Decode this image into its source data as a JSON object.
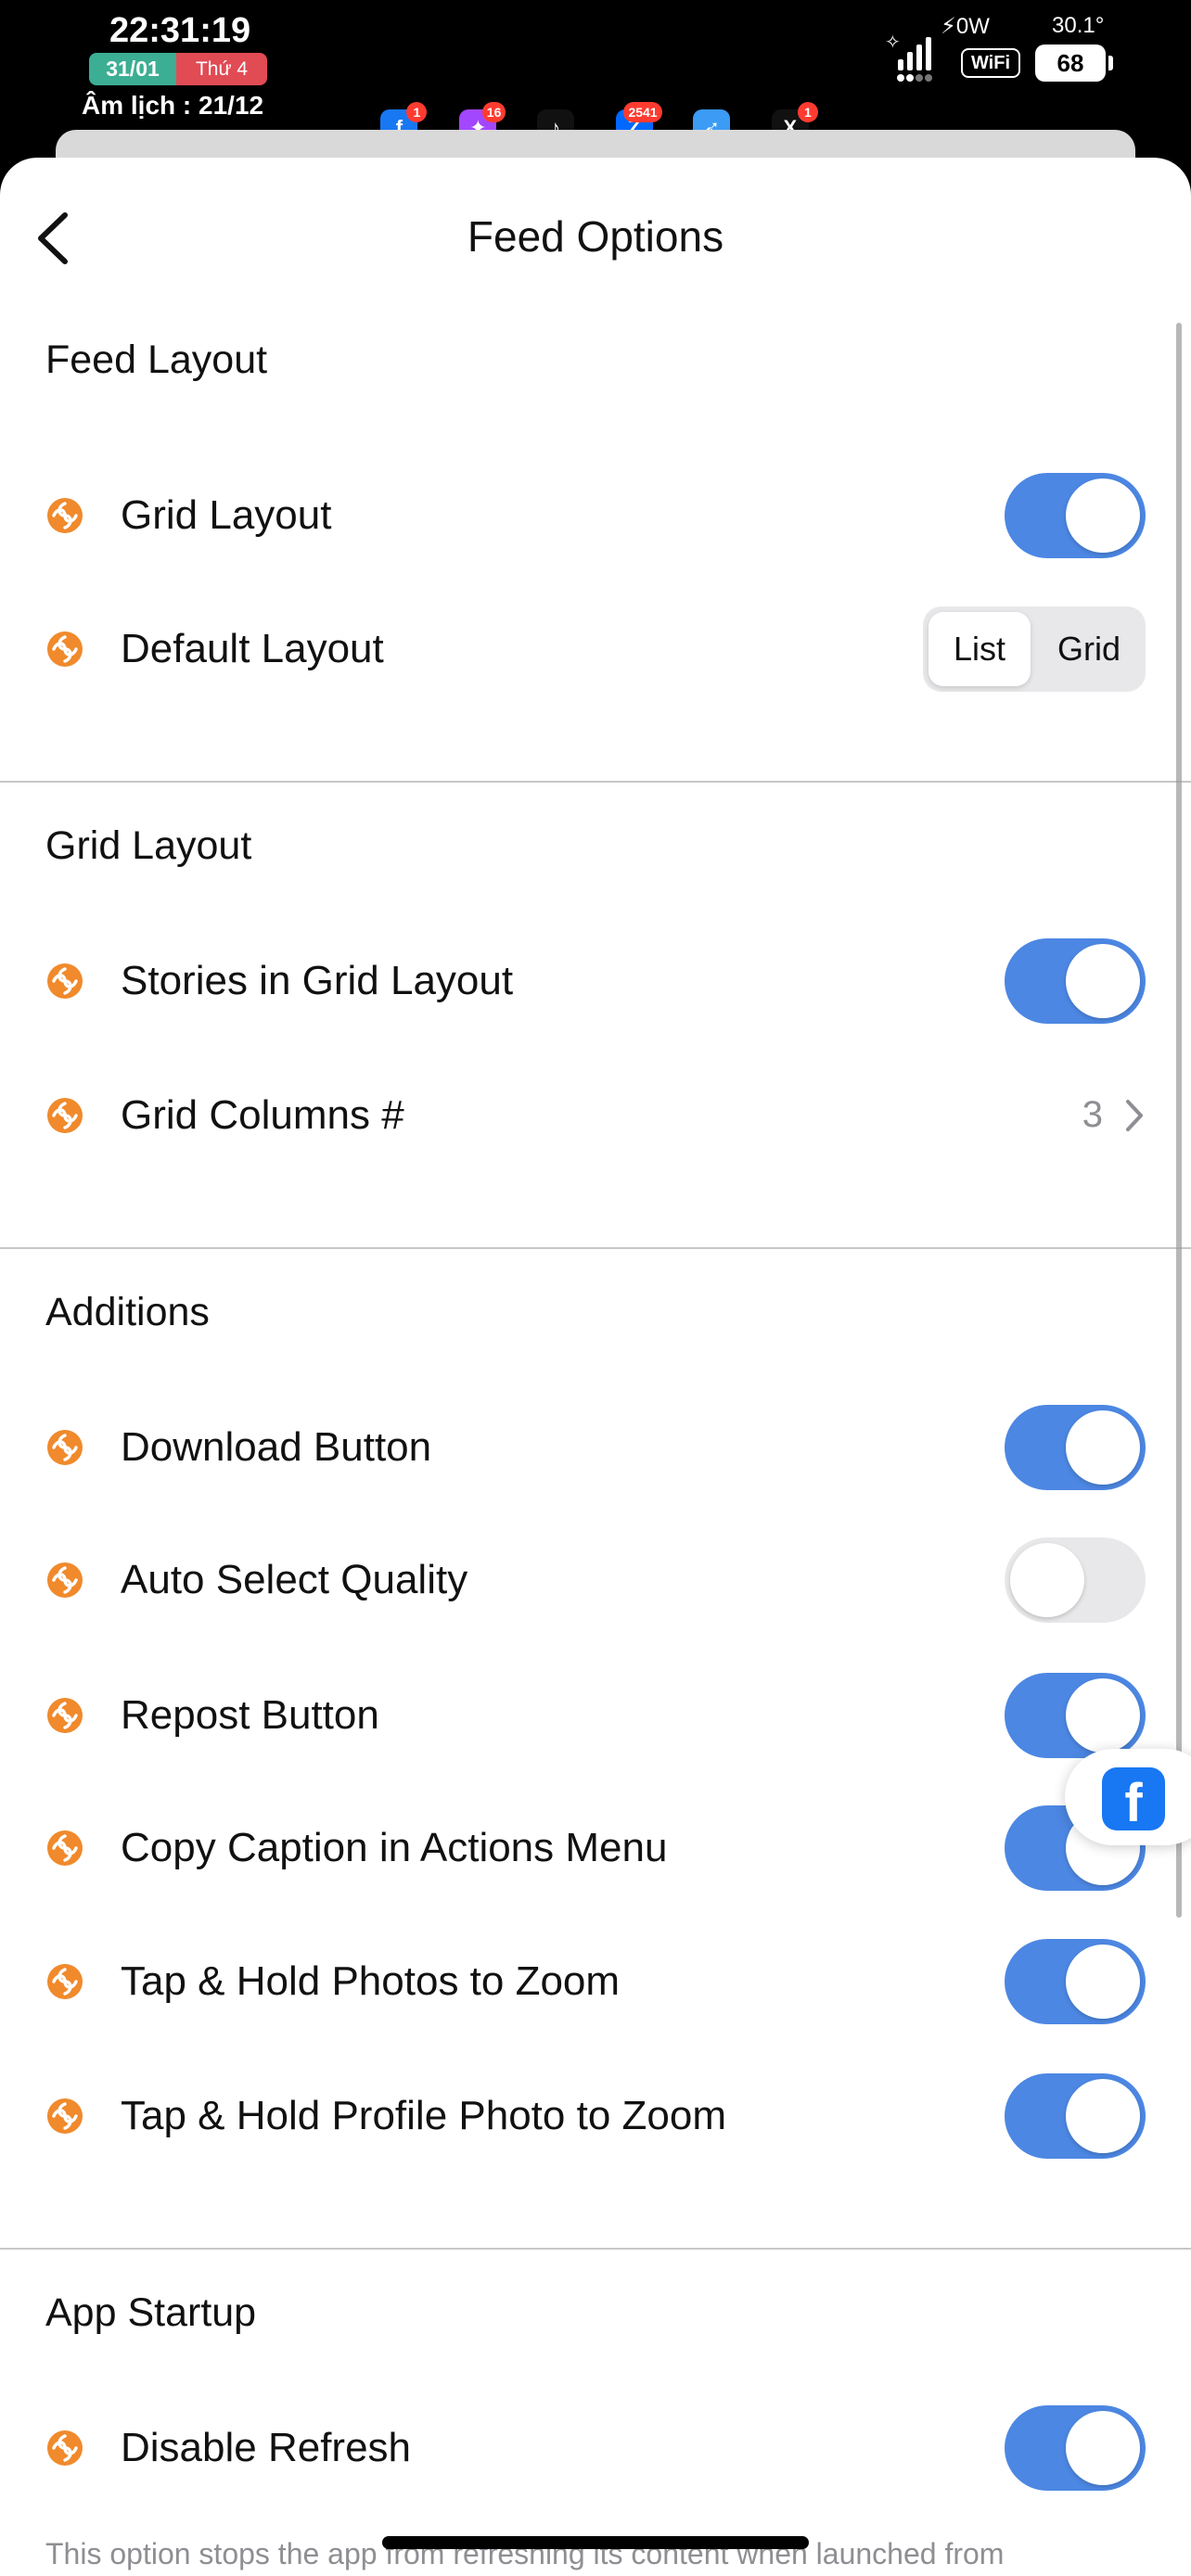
{
  "status_bar": {
    "time": "22:31:19",
    "date": "31/01",
    "weekday": "Thứ 4",
    "lunar": "Âm lịch : 21/12",
    "power": "⚡0W",
    "temperature": "30.1°",
    "wifi_label": "WiFi",
    "battery": "68",
    "apps": [
      {
        "icon": "facebook-icon",
        "glyph": "f",
        "color": "#1877f2",
        "badge": "1"
      },
      {
        "icon": "messenger-icon",
        "glyph": "✦",
        "color": "#a347ff",
        "badge": "16"
      },
      {
        "icon": "tiktok-icon",
        "glyph": "♪",
        "color": "#111111",
        "badge": ""
      },
      {
        "icon": "zalo-icon",
        "glyph": "Z",
        "color": "#0068ff",
        "badge": "2541"
      },
      {
        "icon": "safari-icon",
        "glyph": "➶",
        "color": "#3b9bf5",
        "badge": ""
      },
      {
        "icon": "x-icon",
        "glyph": "X",
        "color": "#111111",
        "badge": "1"
      }
    ]
  },
  "nav": {
    "title": "Feed Options"
  },
  "sections": [
    {
      "title": "Feed Layout",
      "rows": [
        {
          "label": "Grid Layout",
          "control": "toggle",
          "on": true
        },
        {
          "label": "Default Layout",
          "control": "segmented",
          "options": [
            "List",
            "Grid"
          ],
          "selected": "List"
        }
      ]
    },
    {
      "title": "Grid Layout",
      "rows": [
        {
          "label": "Stories in Grid Layout",
          "control": "toggle",
          "on": true
        },
        {
          "label": "Grid Columns #",
          "control": "value",
          "value": "3"
        }
      ]
    },
    {
      "title": "Additions",
      "rows": [
        {
          "label": "Download Button",
          "control": "toggle",
          "on": true
        },
        {
          "label": "Auto Select Quality",
          "control": "toggle",
          "on": false
        },
        {
          "label": "Repost Button",
          "control": "toggle",
          "on": true
        },
        {
          "label": "Copy Caption in Actions Menu",
          "control": "toggle",
          "on": true
        },
        {
          "label": "Tap & Hold Photos to Zoom",
          "control": "toggle",
          "on": true
        },
        {
          "label": "Tap & Hold Profile Photo to Zoom",
          "control": "toggle",
          "on": true
        }
      ]
    },
    {
      "title": "App Startup",
      "rows": [
        {
          "label": "Disable Refresh",
          "control": "toggle",
          "on": true
        }
      ],
      "footnote": "This option stops the app from refreshing its content when launched from"
    }
  ],
  "colors": {
    "accent_blue": "#4c87e3",
    "row_icon_orange": "#f08a2c",
    "toggle_off": "#e8e8ea",
    "facebook_blue": "#1877f2"
  },
  "floating_bubble": {
    "icon": "facebook-icon",
    "glyph": "f"
  }
}
